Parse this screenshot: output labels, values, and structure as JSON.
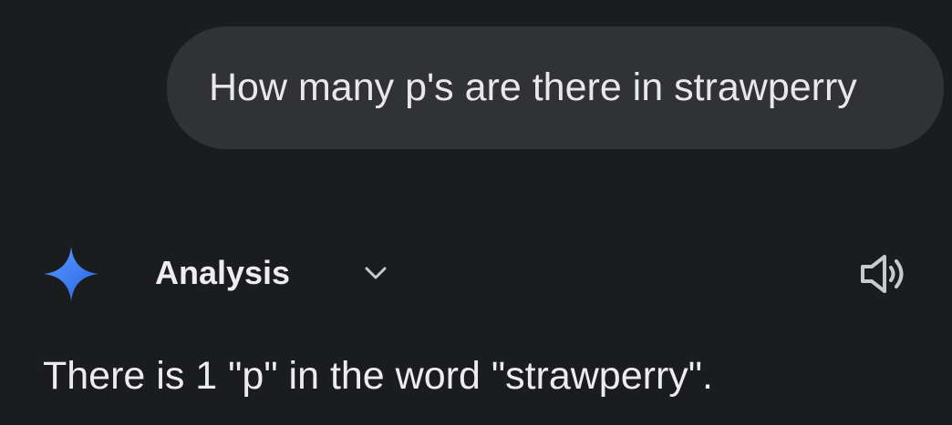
{
  "user_message": {
    "text": "How many p's are there in strawperry"
  },
  "response": {
    "header": {
      "logo_icon": "gemini-sparkle-icon",
      "analysis_label": "Analysis",
      "expand_icon": "chevron-down-icon",
      "speaker_icon": "speaker-icon"
    },
    "text": "There is 1 \"p\" in the word \"strawperry\"."
  },
  "colors": {
    "background": "#1b1c1e",
    "bubble": "#313235",
    "sparkle_start": "#4f8ef7",
    "sparkle_end": "#2f6cf0",
    "icon": "#c9cacd"
  }
}
